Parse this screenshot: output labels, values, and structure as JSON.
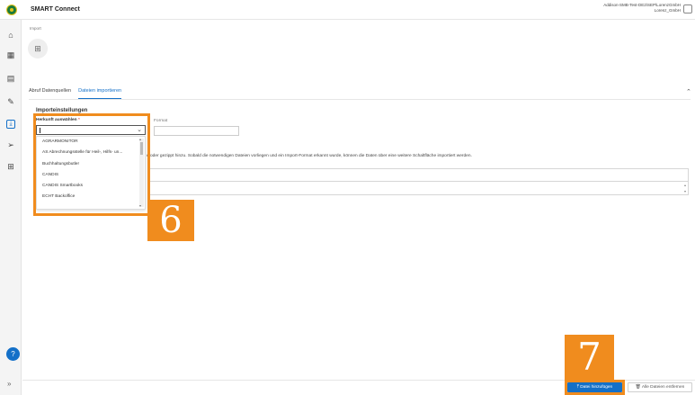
{
  "header": {
    "app_title": "SMART Connect",
    "user_line1": "Addison-SMB-Test-DE2\\SEP\\LorenzGmbH",
    "user_line2": "Lorenz_GmbH"
  },
  "rail": {
    "icons": [
      "home-icon",
      "grid-icon",
      "document-icon",
      "edit-icon",
      "import-icon",
      "send-icon",
      "apps-icon"
    ],
    "help_glyph": "?",
    "expand_glyph": "»"
  },
  "breadcrumb": "Import",
  "tabs": [
    {
      "label": "Abruf Datenquellen",
      "active": false
    },
    {
      "label": "Dateien importieren",
      "active": true
    }
  ],
  "section": {
    "title": "Importeinstellungen"
  },
  "form": {
    "herkunft_label": "Herkunft auswählen",
    "required_mark": "*",
    "format_label": "Format",
    "herkunft_value": "",
    "format_value": ""
  },
  "dropdown": {
    "options": [
      "AGRARMONITOR",
      "AS Abrechnungsstelle für Heil-, Hilfs- un...",
      "Buchhaltungsbutler",
      "CANDIS",
      "CANDIS Smartbooks",
      "ECHT Backoffice"
    ]
  },
  "info_text": "e oder gezippt hinzu. Sobald die notwendigen Dateien vorliegen und ein Import-Format erkannt wurde, können die Daten über eine weitere Schaltfläche importiert werden.",
  "actions": {
    "add_file": "Datei hinzufügen",
    "add_file_icon": "⤒",
    "remove_all": "Alle Dateien entfernen",
    "remove_all_icon": "🗑"
  },
  "callouts": {
    "step6": "6",
    "step7": "7",
    "color": "#f08c1e"
  },
  "colors": {
    "accent": "#1470c8",
    "highlight": "#f08c1e"
  }
}
